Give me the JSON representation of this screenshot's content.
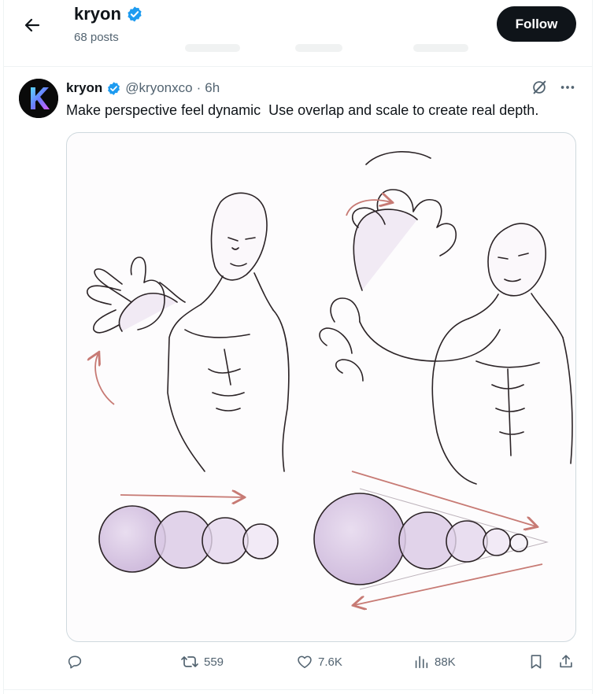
{
  "header": {
    "back_icon": "arrow-left-icon",
    "name": "kryon",
    "posts": "68 posts",
    "follow_label": "Follow"
  },
  "tweet": {
    "author_name": "kryon",
    "handle": "@kryonxco",
    "separator": "·",
    "time": "6h",
    "text": "Make perspective feel dynamic  Use overlap and scale to create real depth.",
    "avatar_letter": "K",
    "media_alt": "perspective drawing reference"
  },
  "actions": {
    "reply_count": "",
    "repost_count": "559",
    "like_count": "7.6K",
    "views_count": "88K"
  },
  "colors": {
    "verified": "#1d9bf0",
    "text_secondary": "#536471",
    "button_bg": "#0f1419",
    "sketch_line": "#2b2326",
    "arrow_red": "#c77a74",
    "lavender": "#d9c9e3"
  }
}
